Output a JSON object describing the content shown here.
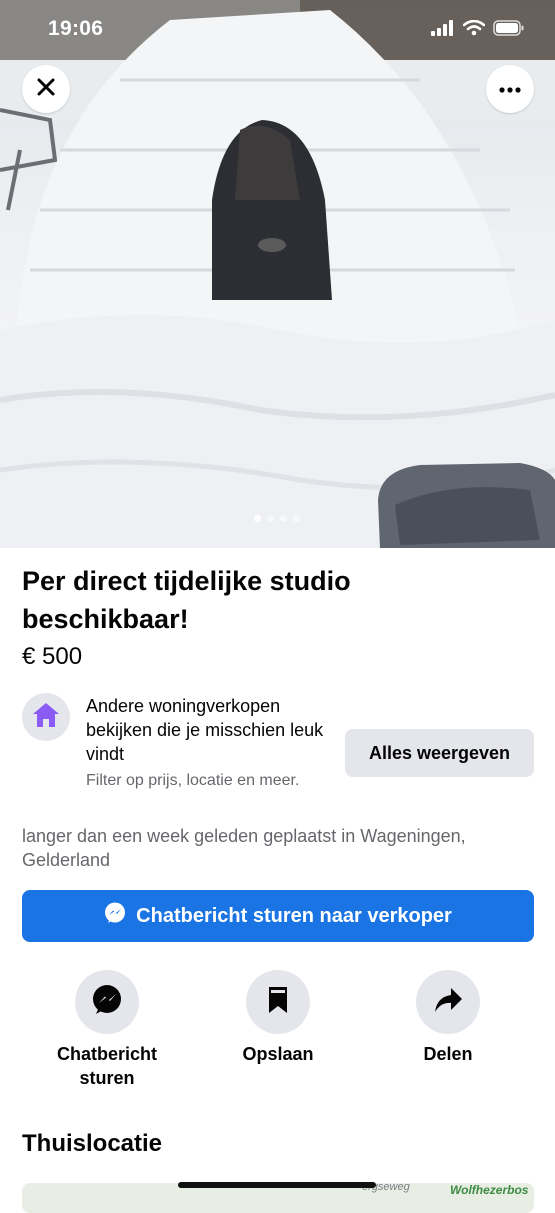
{
  "status_bar": {
    "time": "19:06"
  },
  "listing": {
    "title": "Per direct tijdelijke studio beschikbaar!",
    "price": "€ 500",
    "photo_count": 4,
    "photo_index": 1,
    "posted": "langer dan een week geleden geplaatst in Wageningen, Gelderland"
  },
  "promo": {
    "icon": "house-icon",
    "title": "Andere woningverkopen bekijken die je misschien leuk vindt",
    "subtitle": "Filter op prijs, locatie en meer.",
    "button": "Alles weergeven"
  },
  "primary_action": {
    "label": "Chatbericht sturen naar verkoper",
    "icon": "messenger-icon"
  },
  "actions": [
    {
      "label": "Chatbericht sturen",
      "icon": "messenger-icon"
    },
    {
      "label": "Opslaan",
      "icon": "bookmark-icon"
    },
    {
      "label": "Delen",
      "icon": "share-icon"
    }
  ],
  "location": {
    "title": "Thuislocatie",
    "map_labels": [
      "ergseweg",
      "Wolfhezerbos"
    ]
  },
  "colors": {
    "primary": "#1b74e4",
    "promo_icon": "#8a5cf5",
    "secondary_bg": "#e4e6eb"
  }
}
